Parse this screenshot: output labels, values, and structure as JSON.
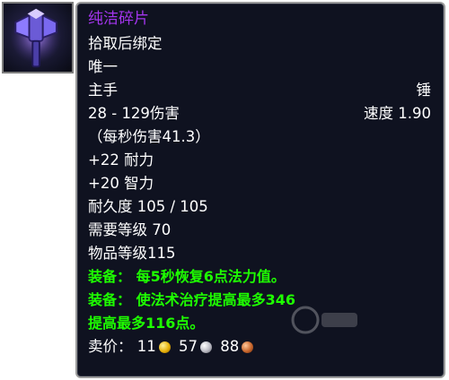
{
  "icon": {
    "name": "mace-icon"
  },
  "tooltip": {
    "title": "纯洁碎片",
    "bind": "拾取后绑定",
    "unique": "唯一",
    "slot": "主手",
    "type": "锤",
    "damage": "28 - 129伤害",
    "speed": "速度 1.90",
    "dps": "（每秒伤害41.3）",
    "stat1": "+22 耐力",
    "stat2": "+20 智力",
    "durability": "耐久度 105 / 105",
    "req_level": "需要等级 70",
    "item_level": "物品等级115",
    "equip1": "装备： 每5秒恢复6点法力值。",
    "equip2": "装备： 使法术治疗提高最多346",
    "equip2_cont": "提高最多116点。",
    "sell_label": "卖价：",
    "gold": "11",
    "silver": "57",
    "copper": "88"
  },
  "colors": {
    "title": "#a335ee",
    "equip": "#1eff00",
    "text": "#ffffff",
    "background": "#0f1220"
  }
}
